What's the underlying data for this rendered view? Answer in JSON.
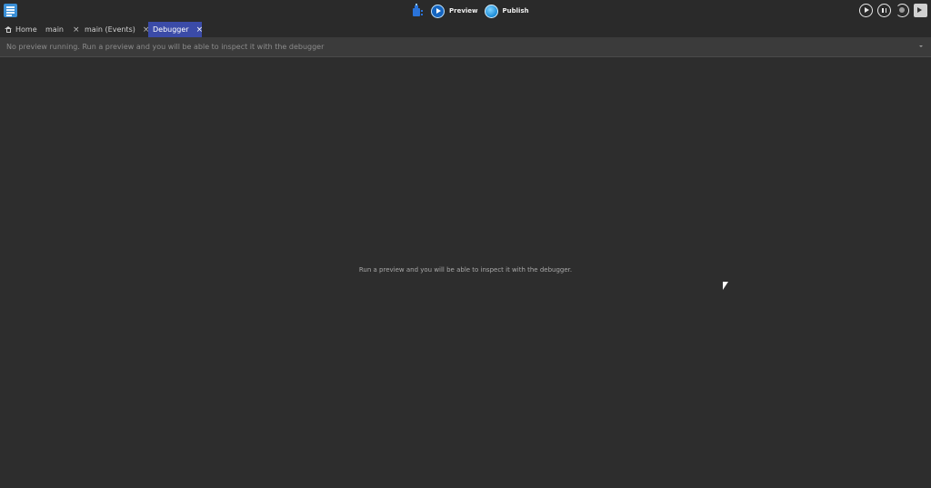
{
  "toolbar": {
    "menu_icon": "hamburger-menu-icon",
    "debug_icon": "debugger-icon",
    "preview_label": "Preview",
    "publish_label": "Publish",
    "right_icons": [
      "play-icon",
      "pause-icon",
      "refresh-icon",
      "terminal-icon"
    ]
  },
  "tabs": [
    {
      "label": "Home",
      "icon": "home-icon",
      "closable": false,
      "active": false
    },
    {
      "label": "main",
      "closable": true,
      "active": false
    },
    {
      "label": "main (Events)",
      "closable": true,
      "active": false
    },
    {
      "label": "Debugger",
      "closable": true,
      "active": true
    }
  ],
  "tab_close_glyph": "×",
  "status": {
    "text": "No preview running. Run a preview and you will be able to inspect it with the debugger"
  },
  "main": {
    "empty_message": "Run a preview and you will be able to inspect it with the debugger."
  },
  "colors": {
    "background": "#2d2d2d",
    "toolbar": "#2a2a2a",
    "active_tab": "#3b4ba8",
    "status_bar": "#3b3b3b",
    "accent": "#1565c0"
  }
}
